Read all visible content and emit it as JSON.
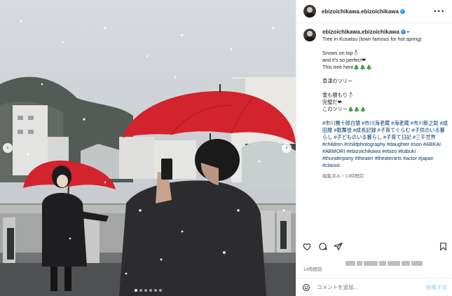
{
  "post": {
    "username": "ebizoichikawa.ebizoichikawa",
    "verified_icon": "verified-badge-icon",
    "more_icon": "more-options-icon",
    "caption_lines": [
      "Tree in Kusatsu (town famous for hot spring)",
      "",
      "Snows on top⛄",
      "and it's so perfect❤",
      "This tree here🎄🎄🎄",
      "",
      "草津のツリー",
      "",
      "雪も積もり⛄",
      "完璧だ❤",
      "このツリー🎄🎄🎄"
    ],
    "hashtags": "#市川團十郎白猿 #市川海老蔵 #海老蔵 #市川新之助 #成田屋 #歌舞伎 #成長記録 #子育てぐらむ #子供のいる暮らし #子どものいる暮らし #子育て日記 #三千世界 #children #childphotography #daughter #son #ABKAI #ABMORI #ebizoichikawa #ebizo #kabuki #thunderparty #theater #theaterarts #actor #japan #classic",
    "edited_meta": "編集済み・13時間前",
    "likes_text": "14時間前",
    "comment_placeholder": "コメントを追加...",
    "post_button": "投稿する"
  },
  "photo": {
    "carousel_dots": 6,
    "active_dot": 0,
    "prev_icon": "chevron-left-icon",
    "next_icon": "chevron-right-icon"
  },
  "actions": {
    "like_icon": "heart-icon",
    "comment_icon": "comment-icon",
    "share_icon": "share-icon",
    "save_icon": "bookmark-icon"
  },
  "colors": {
    "verified": "#3797f0",
    "hashtag": "#00376b",
    "umbrella": "#d3232c",
    "muted": "#737373"
  }
}
